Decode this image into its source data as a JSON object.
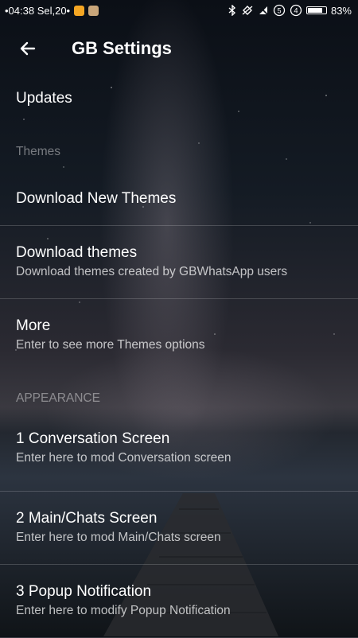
{
  "status_bar": {
    "time_text": "•04:38 Sel,20•",
    "battery_percent_text": "83%",
    "battery_level": 0.83
  },
  "app_bar": {
    "title": "GB Settings",
    "back_icon": "arrow-back-icon"
  },
  "items": {
    "updates": {
      "title": "Updates"
    },
    "themes_header": "Themes",
    "download_new_themes": {
      "title": "Download New Themes"
    },
    "download_themes": {
      "title": "Download themes",
      "subtitle": "Download themes created by GBWhatsApp users"
    },
    "more": {
      "title": "More",
      "subtitle": "Enter to see more Themes options"
    },
    "appearance_header": "APPEARANCE",
    "conversation_screen": {
      "title": "1 Conversation Screen",
      "subtitle": "Enter here to mod Conversation screen"
    },
    "main_chats_screen": {
      "title": "2 Main/Chats Screen",
      "subtitle": "Enter here to mod Main/Chats screen"
    },
    "popup_notification": {
      "title": "3 Popup Notification",
      "subtitle": "Enter here to modify Popup Notification"
    }
  }
}
